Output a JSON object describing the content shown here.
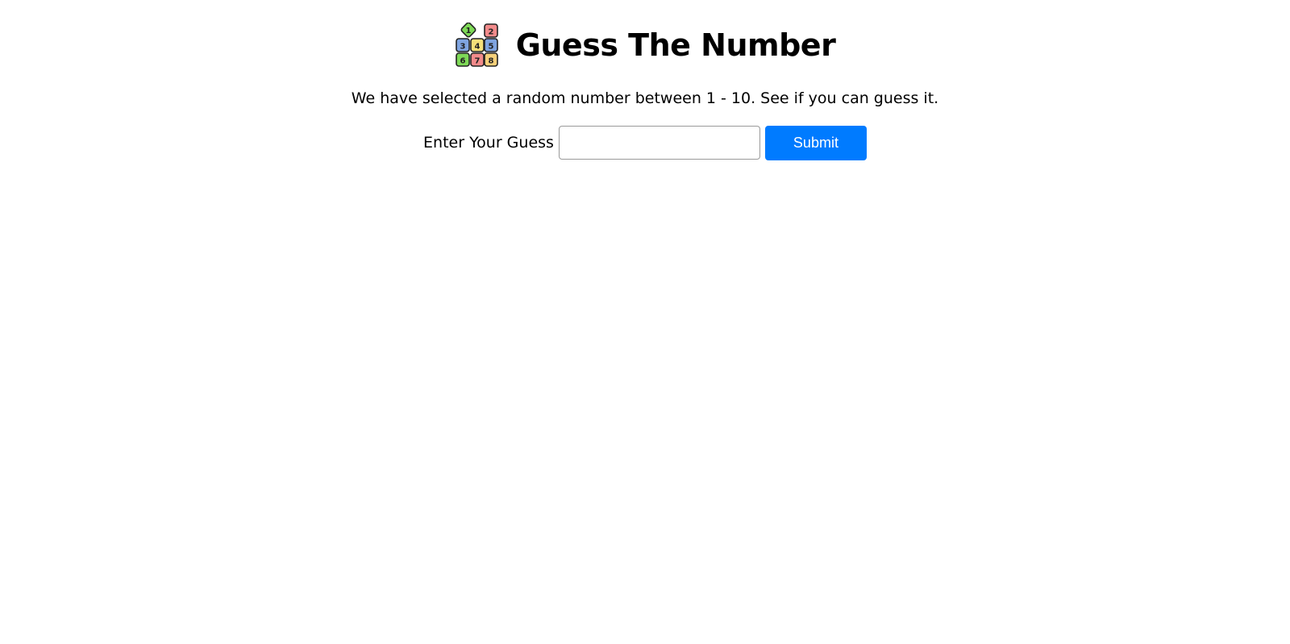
{
  "header": {
    "title": "Guess The Number",
    "logo_icon": "number-blocks-icon",
    "logo_tiles": [
      {
        "label": "1",
        "color": "#7ed957"
      },
      {
        "label": "2",
        "color": "#f28b8b"
      },
      {
        "label": "3",
        "color": "#7fa4e0"
      },
      {
        "label": "4",
        "color": "#f5e07a"
      },
      {
        "label": "5",
        "color": "#7fa4e0"
      },
      {
        "label": "6",
        "color": "#7ed957"
      },
      {
        "label": "7",
        "color": "#f28b8b"
      },
      {
        "label": "8",
        "color": "#f5d07a"
      }
    ]
  },
  "instructions": "We have selected a random number between 1 - 10. See if you can guess it.",
  "form": {
    "label": "Enter Your Guess",
    "input_value": "",
    "input_placeholder": "",
    "submit_label": "Submit"
  },
  "colors": {
    "accent": "#007bff",
    "text": "#000000",
    "background": "#ffffff"
  }
}
